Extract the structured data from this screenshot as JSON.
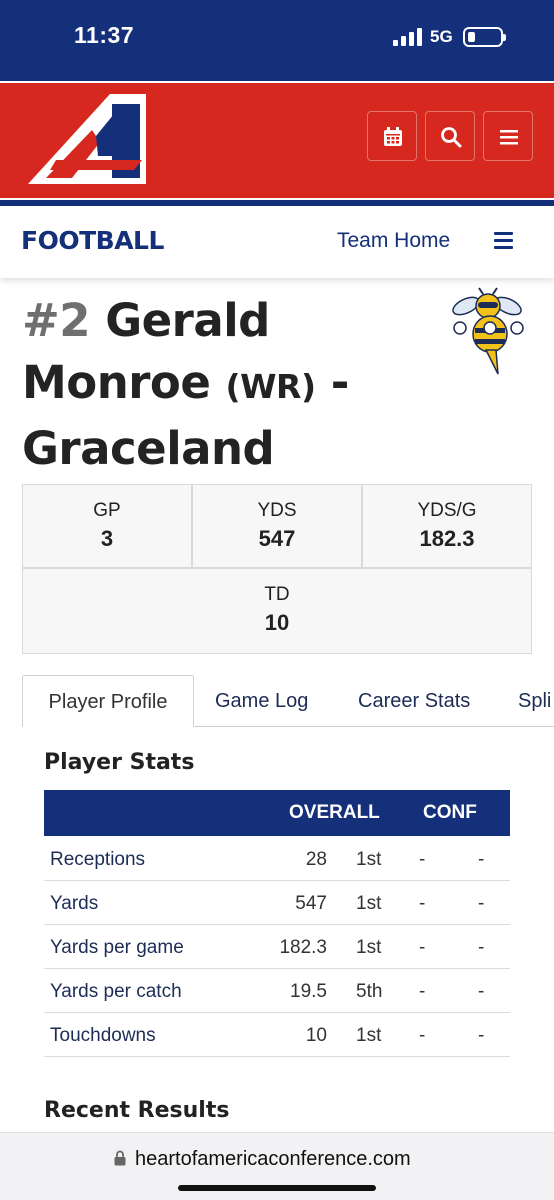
{
  "status_bar": {
    "time": "11:37",
    "network": "5G",
    "battery_level": 0.15
  },
  "header": {
    "logo_icon": "hoa-logo-icon",
    "buttons": [
      {
        "icon": "calendar-icon"
      },
      {
        "icon": "search-icon"
      },
      {
        "icon": "menu-icon"
      }
    ],
    "colors": {
      "red": "#d7281f",
      "navy": "#14307a"
    }
  },
  "sport_nav": {
    "title": "FOOTBALL",
    "team_home": "Team Home",
    "menu_icon": "hamburger-icon"
  },
  "player": {
    "number": "#2",
    "first_name": "Gerald",
    "last_name": "Monroe",
    "position": "(WR)",
    "separator": "-",
    "school": "Graceland",
    "mascot_icon": "yellowjacket-mascot-icon"
  },
  "summary": {
    "gp": {
      "label": "GP",
      "value": "3"
    },
    "yds": {
      "label": "YDS",
      "value": "547"
    },
    "ydsg": {
      "label": "YDS/G",
      "value": "182.3"
    },
    "td": {
      "label": "TD",
      "value": "10"
    }
  },
  "tabs": [
    "Player Profile",
    "Game Log",
    "Career Stats",
    "Spli"
  ],
  "player_stats": {
    "title": "Player Stats",
    "headers": {
      "overall": "OVERALL",
      "conf": "CONF"
    },
    "rows": [
      {
        "name": "Receptions",
        "value": "28",
        "rank": "1st",
        "conf_value": "-",
        "conf_rank": "-"
      },
      {
        "name": "Yards",
        "value": "547",
        "rank": "1st",
        "conf_value": "-",
        "conf_rank": "-"
      },
      {
        "name": "Yards per game",
        "value": "182.3",
        "rank": "1st",
        "conf_value": "-",
        "conf_rank": "-"
      },
      {
        "name": "Yards per catch",
        "value": "19.5",
        "rank": "5th",
        "conf_value": "-",
        "conf_rank": "-"
      },
      {
        "name": "Touchdowns",
        "value": "10",
        "rank": "1st",
        "conf_value": "-",
        "conf_rank": "-"
      }
    ]
  },
  "recent_results": {
    "title": "Recent Results"
  },
  "browser": {
    "url": "heartofamericaconference.com",
    "lock_icon": "lock-icon"
  }
}
